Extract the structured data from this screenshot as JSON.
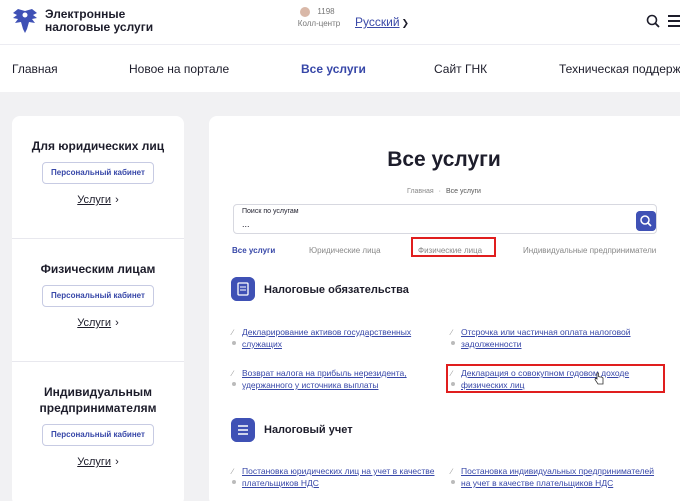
{
  "brand": {
    "line1": "Электронные",
    "line2": "налоговые услуги"
  },
  "contact": {
    "number": "1198",
    "label": "Колл-центр"
  },
  "language": {
    "selected": "Русский"
  },
  "nav": [
    {
      "label": "Главная"
    },
    {
      "label": "Новое на портале"
    },
    {
      "label": "Все услуги",
      "active": true
    },
    {
      "label": "Сайт ГНК"
    },
    {
      "label": "Техническая поддержка"
    }
  ],
  "sidebar": [
    {
      "title_1": "Для юридических лиц",
      "title_2": "",
      "cabinet": "Персональный кабинет",
      "services": "Услуги"
    },
    {
      "title_1": "Физическим лицам",
      "title_2": "",
      "cabinet": "Персональный кабинет",
      "services": "Услуги"
    },
    {
      "title_1": "Индивидуальным",
      "title_2": "предпринимателям",
      "cabinet": "Персональный кабинет",
      "services": "Услуги"
    }
  ],
  "main": {
    "title": "Все услуги",
    "breadcrumb": {
      "home": "Главная",
      "separator": "·",
      "current": "Все услуги"
    },
    "search": {
      "label": "Поиск по услугам",
      "value": "...",
      "placeholder": "Поиск по услугам"
    },
    "tabs": [
      {
        "label": "Все услуги",
        "active": true
      },
      {
        "label": "Юридические лица"
      },
      {
        "label": "Физические лица",
        "highlighted": true
      },
      {
        "label": "Индивидуальные предприниматели"
      }
    ],
    "sections": [
      {
        "title": "Налоговые обязательства",
        "icon": "document-icon",
        "items": [
          {
            "line1": "Декларирование активов государственных",
            "line2": "служащих"
          },
          {
            "line1": "Отсрочка или частичная оплата налоговой",
            "line2": "задолженности"
          },
          {
            "line1": "Возврат налога на прибыль нерезидента,",
            "line2": "удержанного у источника выплаты"
          },
          {
            "line1": "Декларация о совокупном годовом доходе",
            "line2": "физических лиц",
            "highlighted": true
          }
        ]
      },
      {
        "title": "Налоговый учет",
        "icon": "list-icon",
        "items": [
          {
            "line1": "Постановка юридических лиц на учет в качестве",
            "line2": "плательщиков НДС"
          },
          {
            "line1": "Постановка индивидуальных предпринимателей",
            "line2": "на учет в качестве плательщиков НДС"
          }
        ]
      }
    ]
  },
  "colors": {
    "accent": "#3f51b5",
    "highlight": "#e01e1e",
    "background": "#f1f1f3"
  }
}
